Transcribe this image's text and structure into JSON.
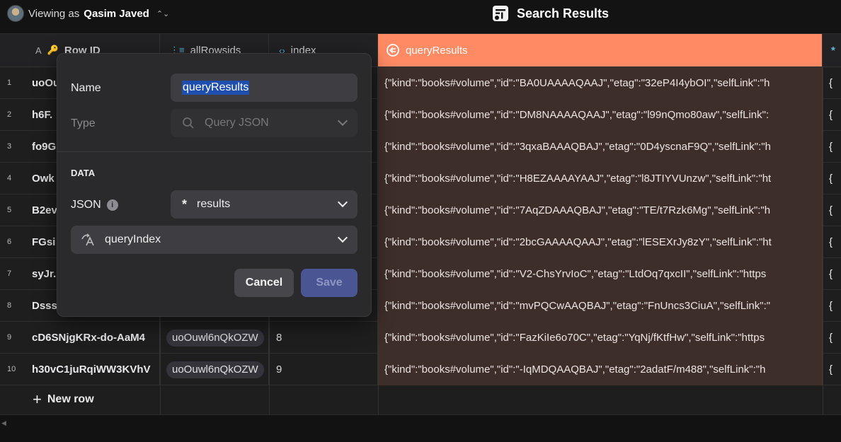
{
  "topbar": {
    "viewing_prefix": "Viewing as",
    "user_name": "Qasim Javed",
    "app_title": "Search Results"
  },
  "columns": {
    "row_id": "Row ID",
    "all_rows_ids": "allRowsids",
    "index": "index",
    "query_results": "queryResults",
    "last_icon": "*"
  },
  "rows": [
    {
      "num": "1",
      "id": "uoOu",
      "chip": "",
      "index": "",
      "qr": "{\"kind\":\"books#volume\",\"id\":\"BA0UAAAAQAAJ\",\"etag\":\"32eP4I4ybOI\",\"selfLink\":\"h",
      "last": "{"
    },
    {
      "num": "2",
      "id": "h6F.",
      "chip": "",
      "index": "",
      "qr": "{\"kind\":\"books#volume\",\"id\":\"DM8NAAAAQAAJ\",\"etag\":\"l99nQmo80aw\",\"selfLink\":",
      "last": "{"
    },
    {
      "num": "3",
      "id": "fo9G",
      "chip": "",
      "index": "",
      "qr": "{\"kind\":\"books#volume\",\"id\":\"3qxaBAAAQBAJ\",\"etag\":\"0D4yscnaF9Q\",\"selfLink\":\"h",
      "last": "{"
    },
    {
      "num": "4",
      "id": "Owk",
      "chip": "",
      "index": "",
      "qr": "{\"kind\":\"books#volume\",\"id\":\"H8EZAAAAYAAJ\",\"etag\":\"l8JTIYVUnzw\",\"selfLink\":\"ht",
      "last": "{"
    },
    {
      "num": "5",
      "id": "B2ev",
      "chip": "",
      "index": "",
      "qr": "{\"kind\":\"books#volume\",\"id\":\"7AqZDAAAQBAJ\",\"etag\":\"TE/t7Rzk6Mg\",\"selfLink\":\"h",
      "last": "{"
    },
    {
      "num": "6",
      "id": "FGsi",
      "chip": "",
      "index": "",
      "qr": "{\"kind\":\"books#volume\",\"id\":\"2bcGAAAAQAAJ\",\"etag\":\"lESEXrJy8zY\",\"selfLink\":\"ht",
      "last": "{"
    },
    {
      "num": "7",
      "id": "syJr.",
      "chip": "",
      "index": "",
      "qr": "{\"kind\":\"books#volume\",\"id\":\"V2-ChsYrvIoC\",\"etag\":\"LtdOq7qxcII\",\"selfLink\":\"https",
      "last": "{"
    },
    {
      "num": "8",
      "id": "Dsss",
      "chip": "",
      "index": "",
      "qr": "{\"kind\":\"books#volume\",\"id\":\"mvPQCwAAQBAJ\",\"etag\":\"FnUncs3CiuA\",\"selfLink\":\"",
      "last": "{"
    },
    {
      "num": "9",
      "id": "cD6SNjgKRx-do-AaM4",
      "chip": "uoOuwl6nQkOZW",
      "index": "8",
      "qr": "{\"kind\":\"books#volume\",\"id\":\"FazKiIe6o70C\",\"etag\":\"YqNj/fKtfHw\",\"selfLink\":\"https",
      "last": "{"
    },
    {
      "num": "10",
      "id": "h30vC1juRqiWW3KVhV",
      "chip": "uoOuwl6nQkOZW",
      "index": "9",
      "qr": "{\"kind\":\"books#volume\",\"id\":\"-IqMDQAAQBAJ\",\"etag\":\"2adatF/m488\",\"selfLink\":\"h",
      "last": "{"
    }
  ],
  "new_row_label": "New row",
  "popover": {
    "name_label": "Name",
    "name_value": "queryResults",
    "type_label": "Type",
    "type_value": "Query JSON",
    "section_label": "DATA",
    "json_label": "JSON",
    "json_value": "results",
    "query_index_value": "queryIndex",
    "cancel_label": "Cancel",
    "save_label": "Save"
  },
  "colors": {
    "highlight_header": "#ff8a63",
    "highlight_cell": "#3e2e2a",
    "selection": "#1f4fae",
    "save_button": "#4a5694"
  }
}
